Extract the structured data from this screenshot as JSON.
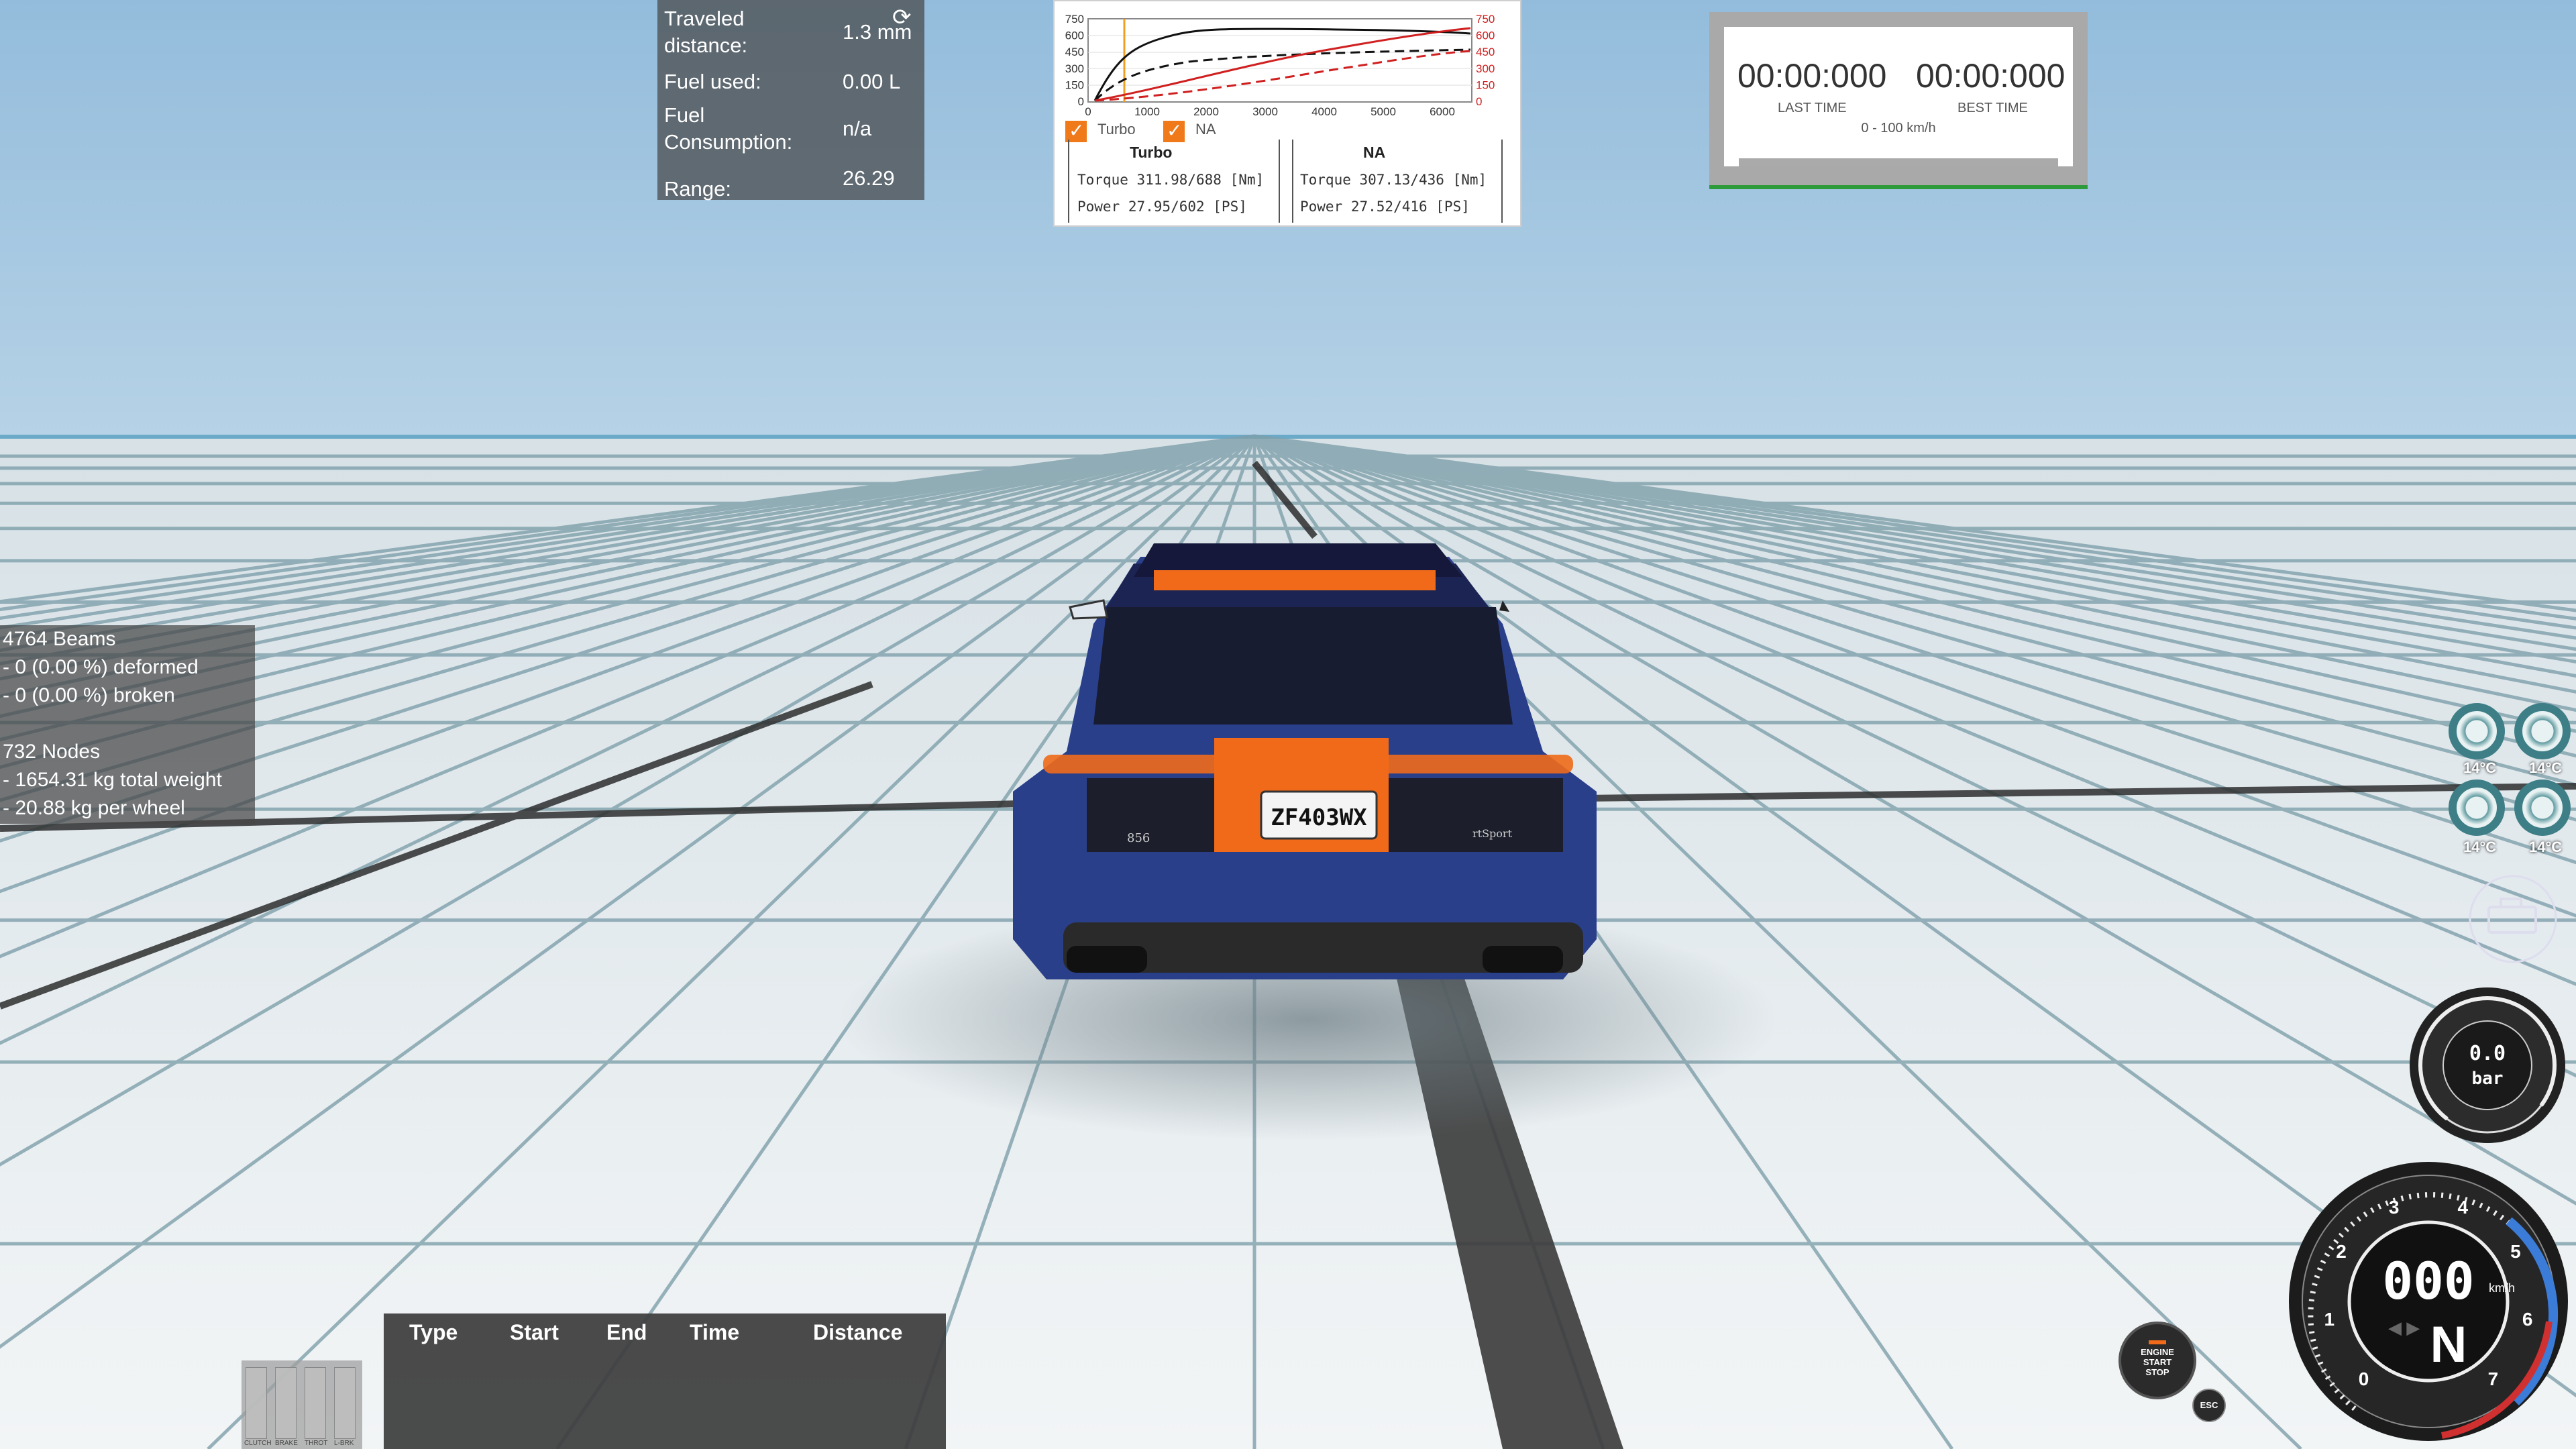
{
  "trip": {
    "traveled_label": "Traveled\ndistance:",
    "traveled_value": "1.3 mm",
    "fuel_used_label": "Fuel used:",
    "fuel_used_value": "0.00 L",
    "consumption_label": "Fuel\nConsumption:",
    "consumption_value": "n/a",
    "range_label": "Range:",
    "range_value": "26.29"
  },
  "torque_graph": {
    "left_axis_ticks": [
      "750",
      "600",
      "450",
      "300",
      "150",
      "0"
    ],
    "right_axis_ticks": [
      "750",
      "600",
      "450",
      "300",
      "150",
      "0"
    ],
    "x_ticks": [
      "0",
      "1000",
      "2000",
      "3000",
      "4000",
      "5000",
      "6000"
    ],
    "turbo_label": "Turbo",
    "na_label": "NA",
    "turbo_header": "Turbo",
    "na_header": "NA",
    "turbo_torque": "Torque 311.98/688 [Nm]",
    "turbo_power": "Power  27.95/602  [PS]",
    "na_torque": "Torque 307.13/436 [Nm]",
    "na_power": "Power  27.52/416  [PS]",
    "turbo_checked": true,
    "na_checked": true
  },
  "timer": {
    "last_time": "00:00:000",
    "best_time": "00:00:000",
    "last_label": "LAST TIME",
    "best_label": "BEST TIME",
    "subtitle": "0 - 100 km/h"
  },
  "beams": {
    "line1": "4764 Beams",
    "line2": "- 0 (0.00 %) deformed",
    "line3": "- 0 (0.00 %) broken",
    "line4": "732 Nodes",
    "line5": "- 1654.31 kg total weight",
    "line6": "- 20.88 kg per wheel"
  },
  "data_table": {
    "headers": [
      "Type",
      "Start",
      "End",
      "Time",
      "Distance"
    ]
  },
  "pedals": {
    "labels": [
      "CLUTCH",
      "BRAKE",
      "THROT",
      "L-BRK"
    ]
  },
  "tyres": {
    "temps": [
      "14°C",
      "14°C",
      "14°C",
      "14°C"
    ]
  },
  "boost_gauge": {
    "value": "0.0",
    "unit": "bar"
  },
  "speedometer": {
    "speed": "000",
    "unit": "km/h",
    "gear": "N",
    "rpm_ticks": [
      "0",
      "1",
      "2",
      "3",
      "4",
      "5",
      "6",
      "7"
    ]
  },
  "engine_button": {
    "label_top": "ENGINE",
    "label_mid": "START",
    "label_bot": "STOP"
  },
  "esc_button": {
    "label": "ESC"
  },
  "license_plate": "ZF403WX",
  "badges": {
    "left": "856",
    "right": "rtSport"
  },
  "colors": {
    "car_body": "#2a3f8a",
    "accent_orange": "#f06a1a",
    "sky": "#9ec3df",
    "ground": "#e8eef0"
  }
}
